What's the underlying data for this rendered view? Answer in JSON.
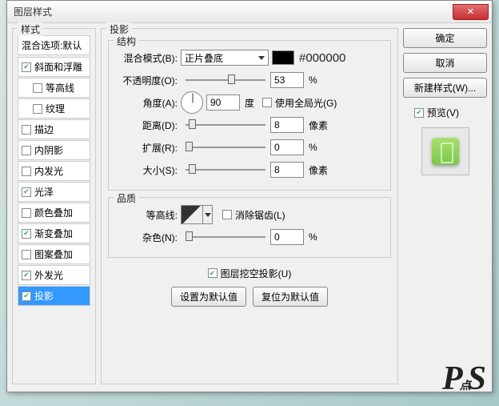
{
  "window": {
    "title": "图层样式"
  },
  "left": {
    "legend": "样式",
    "blend_header": "混合选项:默认",
    "items": [
      {
        "label": "斜面和浮雕",
        "checked": true,
        "sub": false
      },
      {
        "label": "等高线",
        "checked": false,
        "sub": true
      },
      {
        "label": "纹理",
        "checked": false,
        "sub": true
      },
      {
        "label": "描边",
        "checked": false,
        "sub": false
      },
      {
        "label": "内阴影",
        "checked": false,
        "sub": false
      },
      {
        "label": "内发光",
        "checked": false,
        "sub": false
      },
      {
        "label": "光泽",
        "checked": true,
        "sub": false
      },
      {
        "label": "颜色叠加",
        "checked": false,
        "sub": false
      },
      {
        "label": "渐变叠加",
        "checked": true,
        "sub": false
      },
      {
        "label": "图案叠加",
        "checked": false,
        "sub": false
      },
      {
        "label": "外发光",
        "checked": true,
        "sub": false
      },
      {
        "label": "投影",
        "checked": true,
        "sub": false,
        "selected": true
      }
    ]
  },
  "shadow": {
    "legend": "投影",
    "structure": {
      "legend": "结构",
      "blend_mode_label": "混合模式(B):",
      "blend_mode_value": "正片叠底",
      "color_hex": "#000000",
      "opacity_label": "不透明度(O):",
      "opacity_value": "53",
      "opacity_unit": "%",
      "angle_label": "角度(A):",
      "angle_value": "90",
      "angle_unit": "度",
      "global_light_label": "使用全局光(G)",
      "global_light_checked": false,
      "distance_label": "距离(D):",
      "distance_value": "8",
      "distance_unit": "像素",
      "spread_label": "扩展(R):",
      "spread_value": "0",
      "spread_unit": "%",
      "size_label": "大小(S):",
      "size_value": "8",
      "size_unit": "像素"
    },
    "quality": {
      "legend": "品质",
      "contour_label": "等高线:",
      "antialias_label": "消除锯齿(L)",
      "antialias_checked": false,
      "noise_label": "杂色(N):",
      "noise_value": "0",
      "noise_unit": "%"
    },
    "knockout_label": "图层挖空投影(U)",
    "knockout_checked": true,
    "btn_default": "设置为默认值",
    "btn_reset": "复位为默认值"
  },
  "right": {
    "ok": "确定",
    "cancel": "取消",
    "new_style": "新建样式(W)...",
    "preview_label": "预览(V)",
    "preview_checked": true
  },
  "watermark": "P点S"
}
